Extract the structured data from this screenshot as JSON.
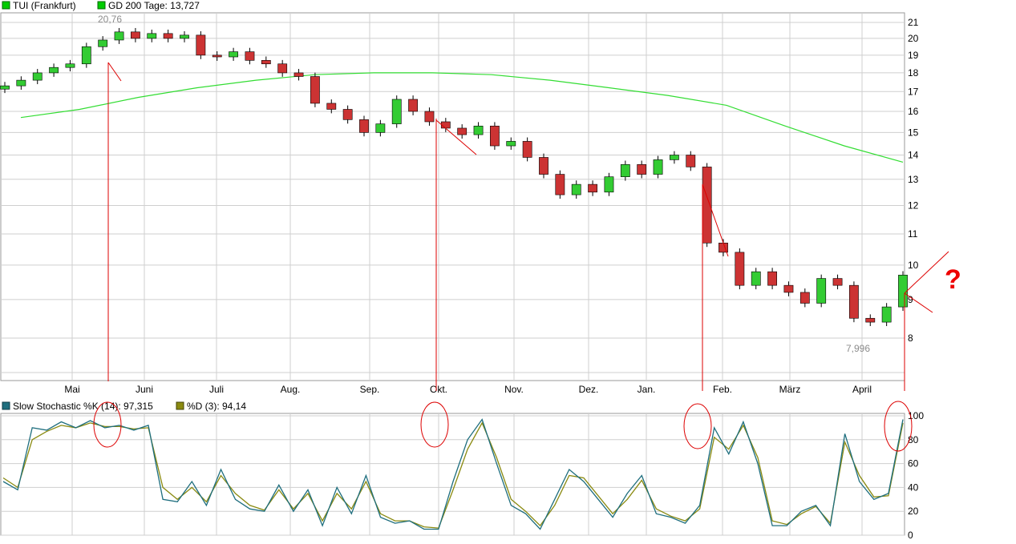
{
  "main_legend": {
    "price_label": "TUI (Frankfurt)",
    "ma_label": "GD 200 Tage: 13,727",
    "price_color": "#00cc00",
    "ma_color": "#00cc00"
  },
  "stoch_legend": {
    "k_label": "Slow Stochastic %K (14): 97,315",
    "d_label": "%D (3): 94,14",
    "k_color": "#1e6e7e",
    "d_color": "#8a8a10"
  },
  "annotations": {
    "high_label": "20,76",
    "low_label": "7,996",
    "question_mark": "?"
  },
  "colors": {
    "up": "#33cc33",
    "down": "#cc3333",
    "drawing": "#dd0000",
    "ma_line": "#33dd33"
  },
  "chart_data": [
    {
      "type": "candlestick",
      "title": "TUI (Frankfurt)",
      "scale": "log",
      "ylim": [
        7,
        21.5
      ],
      "y_ticks": [
        "8",
        "9",
        "10",
        "11",
        "12",
        "13",
        "14",
        "15",
        "16",
        "17",
        "18",
        "19",
        "20",
        "21"
      ],
      "x_ticks": [
        "Mai",
        "Juni",
        "Juli",
        "Aug.",
        "Sep.",
        "Okt.",
        "Nov.",
        "Dez.",
        "Jan.",
        "Feb.",
        "März",
        "April"
      ],
      "grid": true,
      "legend": "top-left",
      "high": 20.76,
      "low": 7.996,
      "series": [
        {
          "name": "TUI (Frankfurt)",
          "values": [
            17.3,
            17.6,
            18.0,
            18.3,
            18.5,
            19.5,
            19.9,
            20.4,
            20.0,
            20.3,
            20.0,
            20.2,
            19.0,
            18.9,
            19.2,
            18.7,
            18.5,
            18.0,
            17.8,
            16.4,
            16.1,
            15.6,
            15.0,
            15.4,
            16.6,
            16.0,
            15.5,
            15.2,
            14.9,
            15.3,
            14.4,
            14.6,
            13.9,
            13.2,
            12.4,
            12.8,
            12.5,
            13.1,
            13.6,
            13.2,
            13.8,
            14.0,
            13.5,
            10.7,
            10.4,
            9.4,
            9.8,
            9.4,
            9.2,
            8.9,
            9.6,
            9.4,
            8.5,
            8.4,
            8.8,
            9.7
          ]
        },
        {
          "name": "GD 200 Tage",
          "values": [
            15.7,
            16.1,
            16.7,
            17.2,
            17.6,
            17.9,
            18.0,
            18.0,
            17.9,
            17.6,
            17.2,
            16.8,
            16.3,
            15.3,
            14.4,
            13.7
          ]
        }
      ]
    },
    {
      "type": "line",
      "title": "Slow Stochastic",
      "ylim": [
        0,
        100
      ],
      "y_ticks": [
        "0",
        "20",
        "40",
        "60",
        "80",
        "100"
      ],
      "x_ticks": [
        "Mai",
        "Juni",
        "Juli",
        "Aug.",
        "Sep.",
        "Okt.",
        "Nov.",
        "Dez.",
        "Jan.",
        "Feb.",
        "März",
        "April"
      ],
      "grid": true,
      "legend": "top-left",
      "series": [
        {
          "name": "Slow Stochastic %K (14)",
          "values": [
            45,
            38,
            90,
            88,
            95,
            90,
            96,
            90,
            92,
            88,
            92,
            30,
            28,
            45,
            25,
            55,
            30,
            22,
            20,
            42,
            20,
            38,
            8,
            40,
            18,
            50,
            15,
            10,
            12,
            5,
            5,
            45,
            80,
            97,
            60,
            25,
            18,
            5,
            30,
            55,
            45,
            30,
            15,
            35,
            50,
            18,
            15,
            10,
            25,
            90,
            68,
            95,
            60,
            8,
            8,
            20,
            25,
            8,
            85,
            45,
            30,
            35,
            97
          ]
        },
        {
          "name": "%D (3)",
          "values": [
            48,
            40,
            80,
            87,
            92,
            90,
            94,
            91,
            91,
            89,
            90,
            40,
            30,
            40,
            28,
            50,
            35,
            25,
            21,
            38,
            22,
            35,
            12,
            35,
            22,
            45,
            18,
            12,
            12,
            7,
            6,
            38,
            72,
            94,
            65,
            30,
            20,
            8,
            25,
            50,
            48,
            33,
            18,
            30,
            46,
            22,
            16,
            12,
            22,
            82,
            72,
            92,
            65,
            12,
            9,
            18,
            24,
            10,
            78,
            50,
            32,
            33,
            94
          ]
        }
      ]
    }
  ]
}
